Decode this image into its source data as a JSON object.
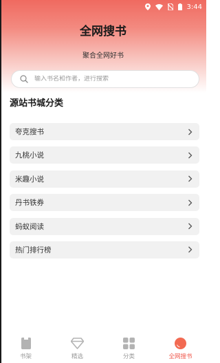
{
  "status_bar": {
    "time": "3:44"
  },
  "header": {
    "title": "全网搜书",
    "subtitle": "聚合全网好书"
  },
  "search": {
    "placeholder": "输入书名和作者，进行搜索"
  },
  "section": {
    "title": "源站书城分类"
  },
  "categories": [
    {
      "label": "夸克搜书"
    },
    {
      "label": "九桃小说"
    },
    {
      "label": "米趣小说"
    },
    {
      "label": "丹书铁券"
    },
    {
      "label": "蚂蚁阅读"
    },
    {
      "label": "热门排行榜"
    }
  ],
  "tabs": [
    {
      "label": "书架",
      "icon": "bookshelf-icon",
      "active": false
    },
    {
      "label": "精选",
      "icon": "diamond-icon",
      "active": false
    },
    {
      "label": "分类",
      "icon": "grid-icon",
      "active": false
    },
    {
      "label": "全网搜书",
      "icon": "search-globe-icon",
      "active": true
    }
  ],
  "colors": {
    "accent": "#f05a4e",
    "header_gradient_top": "#f06a60",
    "inactive": "#9a9a9a"
  }
}
